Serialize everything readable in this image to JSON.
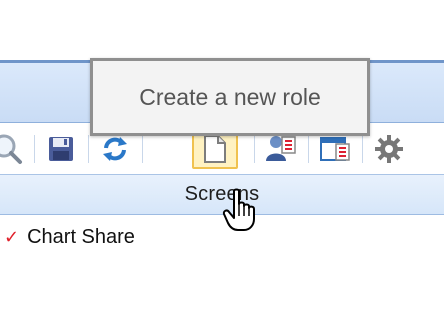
{
  "tooltip": {
    "text": "Create a new role"
  },
  "toolbar": {
    "buttons": [
      {
        "icon": "search-icon"
      },
      {
        "icon": "save-icon"
      },
      {
        "icon": "refresh-icon"
      },
      {
        "icon": "new-document-icon",
        "state": "hovered"
      },
      {
        "icon": "role-permissions-icon"
      },
      {
        "icon": "window-edit-icon"
      },
      {
        "icon": "gear-icon"
      }
    ]
  },
  "section": {
    "title": "Screens"
  },
  "list": {
    "items": [
      {
        "label": "Chart Share",
        "checked": true
      }
    ]
  },
  "colors": {
    "title_bar": "#c9dcf5",
    "active_button_fill": "#fff2c2",
    "active_button_border": "#f0c24f",
    "check_mark": "#e0202a"
  }
}
